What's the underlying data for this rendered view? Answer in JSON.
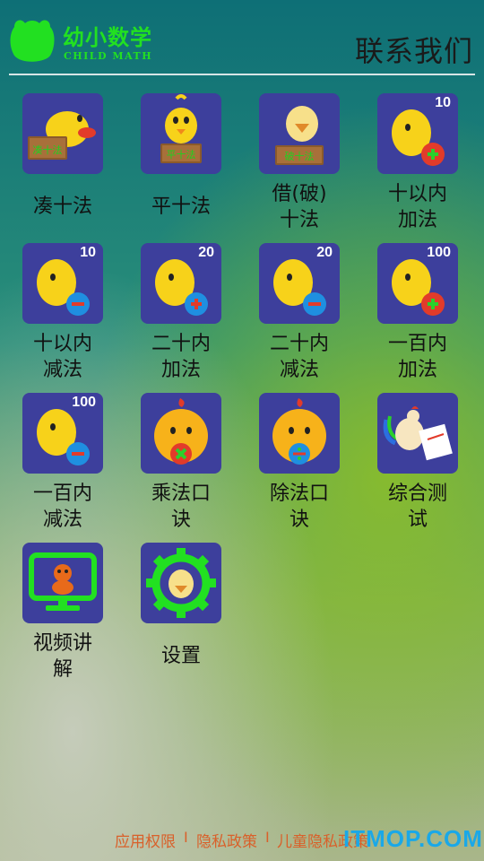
{
  "header": {
    "logo_title": "幼小数学",
    "logo_subtitle": "CHILD MATH",
    "contact_label": "联系我们"
  },
  "tiles": [
    {
      "label": "凑十法",
      "sign": "凑十法",
      "icon": "chick-sign-icon"
    },
    {
      "label": "平十法",
      "sign": "平十法",
      "icon": "chick-sign-icon"
    },
    {
      "label": "借(破)十法",
      "line1": "借(破)",
      "line2": "十法",
      "sign": "破十法",
      "icon": "chick-sign-icon"
    },
    {
      "label": "十以内加法",
      "line1": "十以内",
      "line2": "加法",
      "badge": "10",
      "icon": "chick-plus-icon"
    },
    {
      "label": "十以内减法",
      "line1": "十以内",
      "line2": "减法",
      "badge": "10",
      "icon": "chick-minus-icon"
    },
    {
      "label": "二十内加法",
      "line1": "二十内",
      "line2": "加法",
      "badge": "20",
      "icon": "chick-plus-icon"
    },
    {
      "label": "二十内减法",
      "line1": "二十内",
      "line2": "减法",
      "badge": "20",
      "icon": "chick-minus-icon"
    },
    {
      "label": "一百内加法",
      "line1": "一百内",
      "line2": "加法",
      "badge": "100",
      "icon": "chick-plus-icon"
    },
    {
      "label": "一百内减法",
      "line1": "一百内",
      "line2": "减法",
      "badge": "100",
      "icon": "chick-minus-icon"
    },
    {
      "label": "乘法口诀",
      "line1": "乘法口",
      "line2": "诀",
      "icon": "hen-multiply-icon"
    },
    {
      "label": "除法口诀",
      "line1": "除法口",
      "line2": "诀",
      "icon": "hen-divide-icon"
    },
    {
      "label": "综合测试",
      "line1": "综合测",
      "line2": "试",
      "icon": "rooster-test-icon"
    },
    {
      "label": "视频讲解",
      "line1": "视频讲",
      "line2": "解",
      "icon": "video-monitor-icon"
    },
    {
      "label": "设置",
      "icon": "settings-gear-icon"
    }
  ],
  "footer": {
    "links": [
      "应用权限",
      "隐私政策",
      "儿童隐私政策"
    ],
    "separator": "I"
  },
  "watermark": "ITMOP.COM",
  "colors": {
    "accent_green": "#22e021",
    "tile_bg": "#3d3f9c",
    "footer_link": "#d9602a",
    "watermark": "#1aa8e8"
  }
}
